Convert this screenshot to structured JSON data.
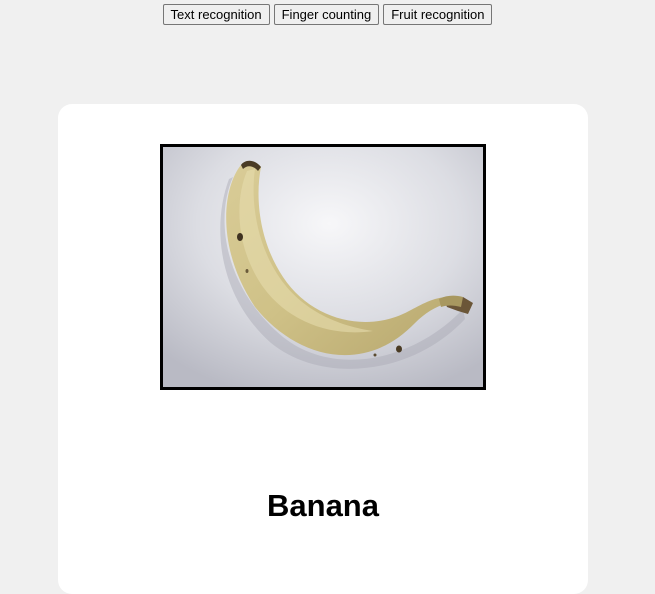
{
  "toolbar": {
    "buttons": [
      {
        "label": "Text recognition"
      },
      {
        "label": "Finger counting"
      },
      {
        "label": "Fruit recognition"
      }
    ]
  },
  "camera": {
    "subject_icon": "banana-photo"
  },
  "result": {
    "label": "Banana"
  }
}
